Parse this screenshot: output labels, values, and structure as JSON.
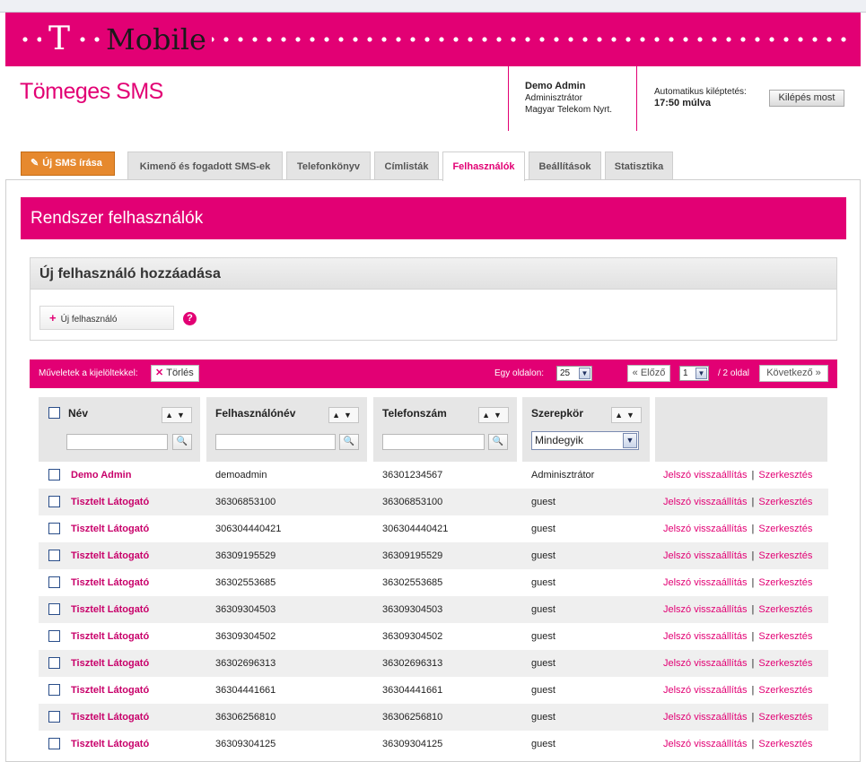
{
  "brand": {
    "logo_t": "T",
    "logo_text": "Mobile",
    "accent_color": "#e20074"
  },
  "app_title": "Tömeges SMS",
  "user": {
    "name": "Demo Admin",
    "role": "Adminisztrátor",
    "company": "Magyar Telekom Nyrt."
  },
  "logout": {
    "label": "Automatikus kiléptetés:",
    "time": "17:50 múlva",
    "button": "Kilépés most"
  },
  "nav": {
    "new_sms": "Új SMS írása",
    "tabs": [
      "Kimenő és fogadott SMS-ek",
      "Telefonkönyv",
      "Címlisták",
      "Felhasználók",
      "Beállítások",
      "Statisztika"
    ],
    "active_tab": "Felhasználók"
  },
  "page_title": "Rendszer felhasználók",
  "add_user": {
    "title": "Új felhasználó hozzáadása",
    "button": "Új felhasználó",
    "help": "?"
  },
  "actions": {
    "label": "Műveletek a kijelöltekkel:",
    "delete": "Törlés",
    "per_page_label": "Egy oldalon:",
    "per_page": "25",
    "prev": "« Előző",
    "page": "1",
    "pages": "/ 2 oldal",
    "next": "Következő »"
  },
  "table": {
    "headers": {
      "name": "Név",
      "username": "Felhasználónév",
      "phone": "Telefonszám",
      "role": "Szerepkör"
    },
    "role_filter": "Mindegyik",
    "link_reset": "Jelszó visszaállítás",
    "link_edit": "Szerkesztés",
    "link_sep": "|",
    "rows": [
      {
        "name": "Demo Admin",
        "username": "demoadmin",
        "phone": "36301234567",
        "role": "Adminisztrátor"
      },
      {
        "name": "Tisztelt Látogató",
        "username": "36306853100",
        "phone": "36306853100",
        "role": "guest"
      },
      {
        "name": "Tisztelt Látogató",
        "username": "306304440421",
        "phone": "306304440421",
        "role": "guest"
      },
      {
        "name": "Tisztelt Látogató",
        "username": "36309195529",
        "phone": "36309195529",
        "role": "guest"
      },
      {
        "name": "Tisztelt Látogató",
        "username": "36302553685",
        "phone": "36302553685",
        "role": "guest"
      },
      {
        "name": "Tisztelt Látogató",
        "username": "36309304503",
        "phone": "36309304503",
        "role": "guest"
      },
      {
        "name": "Tisztelt Látogató",
        "username": "36309304502",
        "phone": "36309304502",
        "role": "guest"
      },
      {
        "name": "Tisztelt Látogató",
        "username": "36302696313",
        "phone": "36302696313",
        "role": "guest"
      },
      {
        "name": "Tisztelt Látogató",
        "username": "36304441661",
        "phone": "36304441661",
        "role": "guest"
      },
      {
        "name": "Tisztelt Látogató",
        "username": "36306256810",
        "phone": "36306256810",
        "role": "guest"
      },
      {
        "name": "Tisztelt Látogató",
        "username": "36309304125",
        "phone": "36309304125",
        "role": "guest"
      }
    ]
  }
}
